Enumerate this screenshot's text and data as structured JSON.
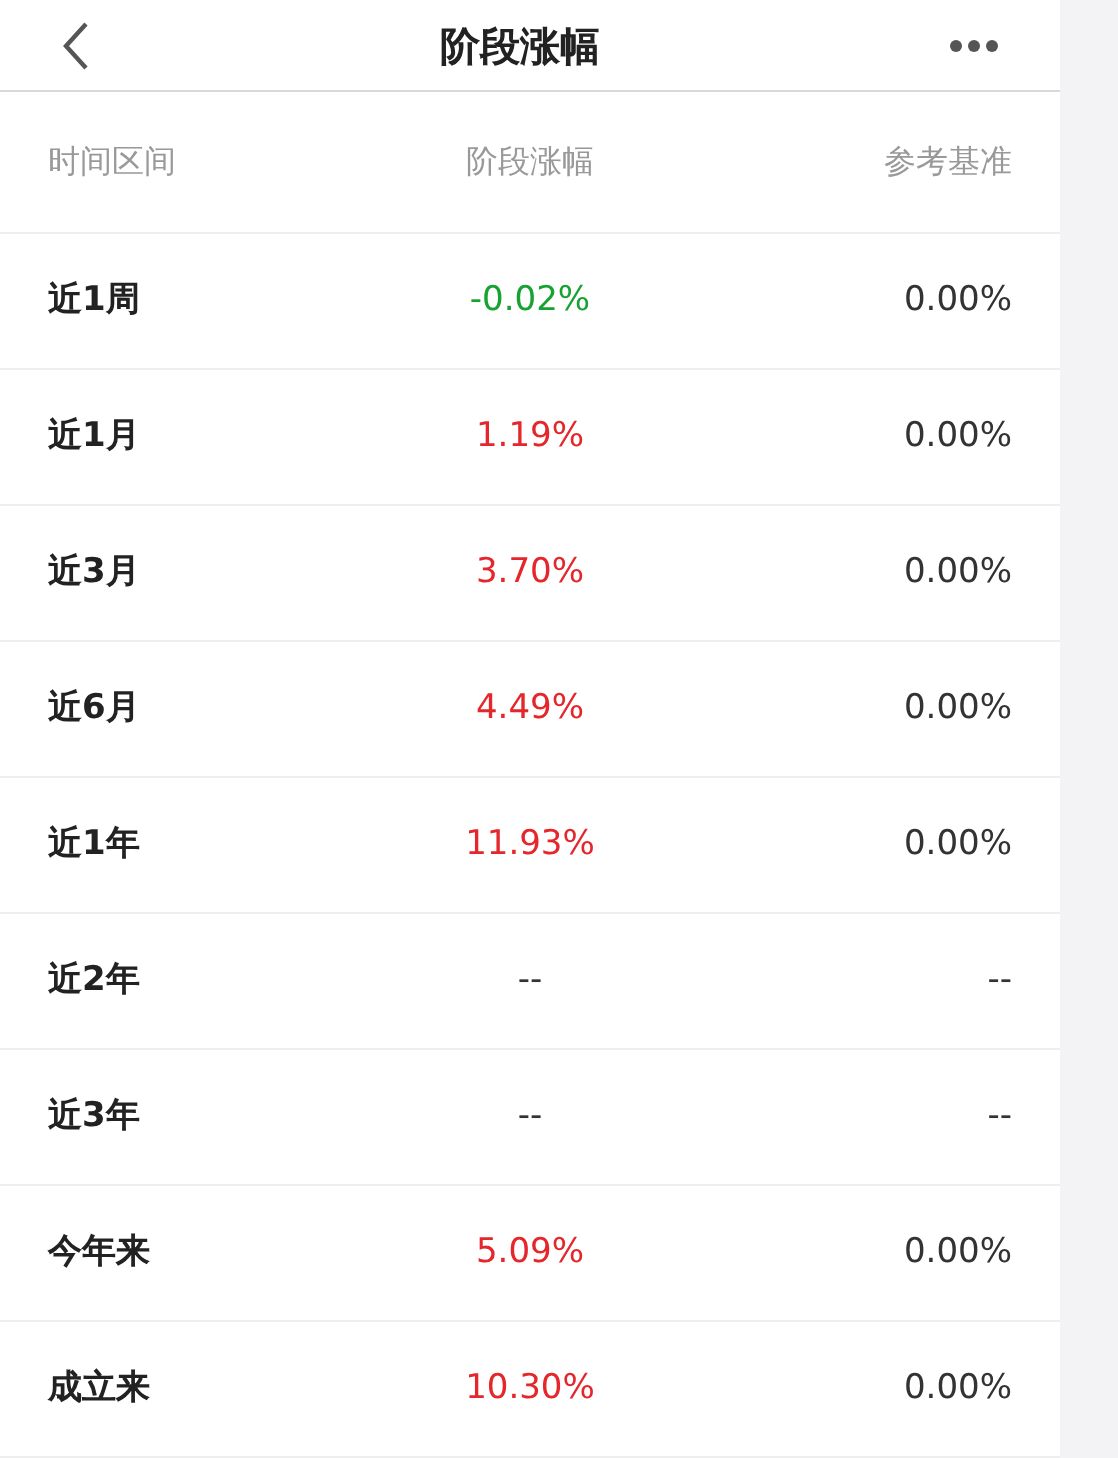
{
  "header": {
    "title": "阶段涨幅"
  },
  "columns": [
    "时间区间",
    "阶段涨幅",
    "参考基准"
  ],
  "rows": [
    {
      "period": "近1周",
      "change": "-0.02%",
      "color": "#17a232",
      "benchmark": "0.00%"
    },
    {
      "period": "近1月",
      "change": "1.19%",
      "color": "#e5262b",
      "benchmark": "0.00%"
    },
    {
      "period": "近3月",
      "change": "3.70%",
      "color": "#e5262b",
      "benchmark": "0.00%"
    },
    {
      "period": "近6月",
      "change": "4.49%",
      "color": "#e5262b",
      "benchmark": "0.00%"
    },
    {
      "period": "近1年",
      "change": "11.93%",
      "color": "#e5262b",
      "benchmark": "0.00%"
    },
    {
      "period": "近2年",
      "change": "--",
      "color": "#333333",
      "benchmark": "--"
    },
    {
      "period": "近3年",
      "change": "--",
      "color": "#333333",
      "benchmark": "--"
    },
    {
      "period": "今年来",
      "change": "5.09%",
      "color": "#e5262b",
      "benchmark": "0.00%"
    },
    {
      "period": "成立来",
      "change": "10.30%",
      "color": "#e5262b",
      "benchmark": "0.00%"
    }
  ]
}
